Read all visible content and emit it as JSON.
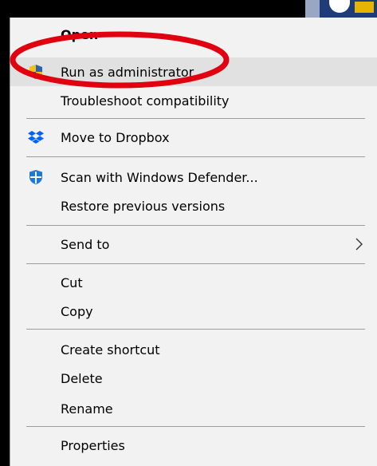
{
  "menu": {
    "items": [
      {
        "label": "Open"
      },
      {
        "label": "Run as administrator",
        "icon": "uac-shield-icon"
      },
      {
        "label": "Troubleshoot compatibility"
      },
      {
        "label": "Move to Dropbox",
        "icon": "dropbox-icon"
      },
      {
        "label": "Scan with Windows Defender...",
        "icon": "windows-defender-icon"
      },
      {
        "label": "Restore previous versions"
      },
      {
        "label": "Send to",
        "submenu": true
      },
      {
        "label": "Cut"
      },
      {
        "label": "Copy"
      },
      {
        "label": "Create shortcut"
      },
      {
        "label": "Delete"
      },
      {
        "label": "Rename"
      },
      {
        "label": "Properties"
      }
    ],
    "highlighted_item": "Run as administrator"
  },
  "annotation": {
    "shape": "ellipse",
    "color": "#e0000f",
    "target": "Run as administrator"
  },
  "colors": {
    "menu_background": "#f2f2f2",
    "hover_background": "#e1e1e1",
    "separator": "#9c9c9c",
    "dropbox_blue": "#0061fe",
    "defender_blue": "#1d79d6",
    "shield_blue": "#2d5fb6",
    "shield_yellow": "#f4c20d"
  }
}
